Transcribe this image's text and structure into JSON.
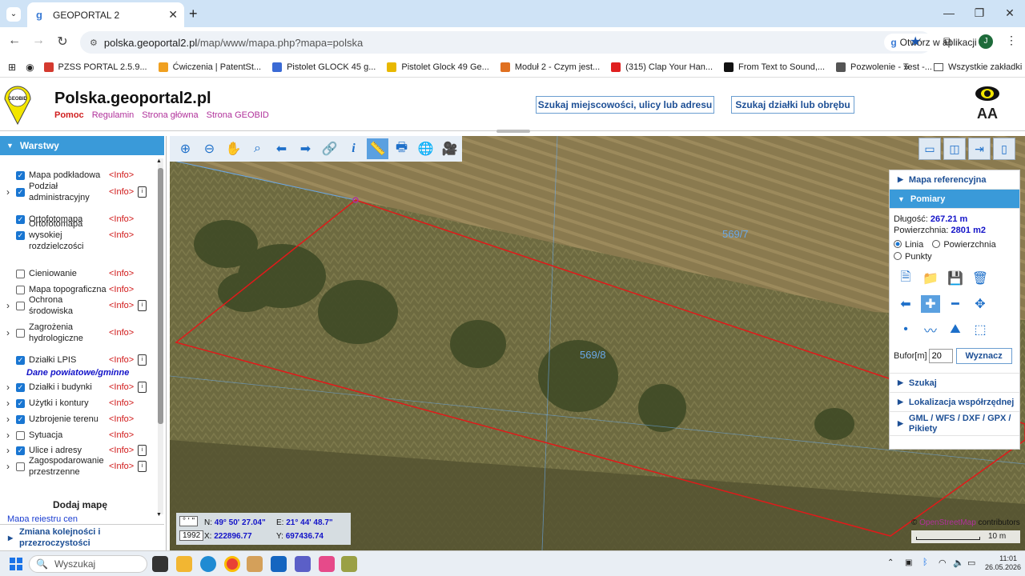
{
  "browser": {
    "tab_title": "GEOPORTAL 2",
    "url_host": "polska.geoportal2.pl",
    "url_path": "/map/www/mapa.php?mapa=polska",
    "open_app_label": "Otwórz w aplikacji",
    "profile_initial": "J",
    "all_bookmarks": "Wszystkie zakładki",
    "bookmarks": [
      {
        "label": "PZSS PORTAL 2.5.9...",
        "color": "#d43a2f"
      },
      {
        "label": "Ćwiczenia | PatentSt...",
        "color": "#f0a020"
      },
      {
        "label": "Pistolet GLOCK 45 g...",
        "color": "#3a6ad5"
      },
      {
        "label": "Pistolet Glock 49 Ge...",
        "color": "#e8b800"
      },
      {
        "label": "Moduł 2 - Czym jest...",
        "color": "#e07020"
      },
      {
        "label": "(315) Clap Your Han...",
        "color": "#e02020"
      },
      {
        "label": "From Text to Sound,...",
        "color": "#111111"
      },
      {
        "label": "Pozwolenie - Test -...",
        "color": "#555555"
      }
    ]
  },
  "header": {
    "logo_text": "GEOBID",
    "title": "Polska.geoportal2.pl",
    "links": [
      "Pomoc",
      "Regulamin",
      "Strona główna",
      "Strona GEOBID"
    ],
    "search_address_btn": "Szukaj miejscowości, ulicy lub adresu",
    "search_parcel_btn": "Szukaj działki lub obrębu",
    "font_size_label": "AA"
  },
  "sidebar": {
    "title": "Warstwy",
    "layers": [
      {
        "label": "Mapa podkładowa",
        "checked": true,
        "expand": false,
        "doc": false
      },
      {
        "label": "Podział administracyjny",
        "checked": true,
        "expand": true,
        "doc": true
      },
      {
        "label": "Ortofotomapa",
        "checked": true,
        "expand": false,
        "doc": false
      },
      {
        "label": "Ortofotomapa wysokiej rozdzielczości",
        "checked": true,
        "expand": false,
        "doc": false
      },
      {
        "label": "Cieniowanie",
        "checked": false,
        "expand": false,
        "doc": false
      },
      {
        "label": "Mapa topograficzna",
        "checked": false,
        "expand": false,
        "doc": false
      },
      {
        "label": "Ochrona środowiska",
        "checked": false,
        "expand": true,
        "doc": true
      },
      {
        "label": "Zagrożenia hydrologiczne",
        "checked": false,
        "expand": true,
        "doc": false
      },
      {
        "label": "Działki LPIS",
        "checked": true,
        "expand": false,
        "doc": true
      }
    ],
    "section_powiat": "Dane powiatowe/gminne",
    "layers2": [
      {
        "label": "Działki i budynki",
        "checked": true,
        "expand": true,
        "doc": true
      },
      {
        "label": "Użytki i kontury",
        "checked": true,
        "expand": true,
        "doc": false
      },
      {
        "label": "Uzbrojenie terenu",
        "checked": true,
        "expand": true,
        "doc": false
      },
      {
        "label": "Sytuacja",
        "checked": false,
        "expand": true,
        "doc": false
      },
      {
        "label": "Ulice i adresy",
        "checked": true,
        "expand": true,
        "doc": true
      },
      {
        "label": "Zagospodarowanie przestrzenne",
        "checked": false,
        "expand": true,
        "doc": true
      }
    ],
    "info_label": "<Info>",
    "add_map": "Dodaj mapę",
    "map_registry": "Mapa rejestru cen",
    "order_label": "Zmiana kolejności i przezroczystości"
  },
  "map": {
    "parcel_labels": [
      "569/7",
      "569/8"
    ],
    "attribution_prefix": "©",
    "attribution_link": "OpenStreetMap",
    "attribution_suffix": "contributors",
    "scale_label": "10 m",
    "coords": {
      "format_tag": "° ' \"",
      "crs_tag": "1992",
      "n_label": "N:",
      "n_value": "49° 50' 27.04\"",
      "e_label": "E:",
      "e_value": "21° 44' 48.7\"",
      "x_label": "X:",
      "x_value": "222896.77",
      "y_label": "Y:",
      "y_value": "697436.74"
    }
  },
  "panel": {
    "ref_map": "Mapa referencyjna",
    "pomiary": "Pomiary",
    "length_label": "Długość:",
    "length_value": "267.21 m",
    "area_label": "Powierzchnia:",
    "area_value": "2801 m2",
    "mode_line": "Linia",
    "mode_area": "Powierzchnia",
    "mode_points": "Punkty",
    "buffer_label": "Bufor[m]",
    "buffer_value": "20",
    "determine_btn": "Wyznacz",
    "search": "Szukaj",
    "coord_loc": "Lokalizacja współrzędnej",
    "gml": "GML / WFS / DXF / GPX / Pikiety"
  },
  "taskbar": {
    "search_placeholder": "Wyszukaj",
    "time": "11:01",
    "date": "26.05.2026"
  }
}
